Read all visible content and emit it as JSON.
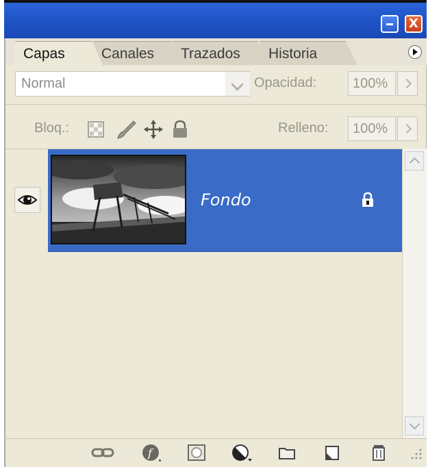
{
  "window": {
    "minimize_label": "",
    "close_label": "X"
  },
  "tabs": [
    {
      "label": "Capas",
      "active": true
    },
    {
      "label": "Canales",
      "active": false
    },
    {
      "label": "Trazados",
      "active": false
    },
    {
      "label": "Historia",
      "active": false
    }
  ],
  "options": {
    "blend_mode": "Normal",
    "opacity_label": "Opacidad:",
    "opacity_value": "100%",
    "lock_label": "Bloq.:",
    "fill_label": "Relleno:",
    "fill_value": "100%"
  },
  "layers": [
    {
      "name": "Fondo",
      "visible": true,
      "locked": true,
      "selected": true
    }
  ],
  "colors": {
    "selection": "#3a6bc6",
    "panel_bg": "#ece9d8",
    "titlebar": "#2b64d8"
  },
  "bottom_icons": [
    "link-layers-icon",
    "layer-style-icon",
    "layer-mask-icon",
    "adjustment-layer-icon",
    "new-group-icon",
    "new-layer-icon",
    "trash-icon"
  ]
}
